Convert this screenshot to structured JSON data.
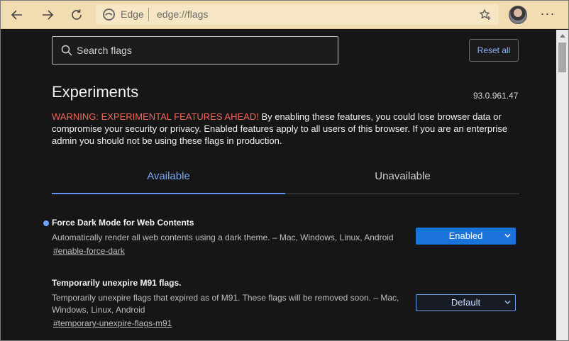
{
  "browser": {
    "site_label": "Edge",
    "url": "edge://flags",
    "icons": [
      "back-icon",
      "forward-icon",
      "refresh-icon",
      "edge-logo-icon",
      "favorite-icon",
      "more-icon"
    ],
    "more_label": "···"
  },
  "header": {
    "search_placeholder": "Search flags",
    "reset_label": "Reset all",
    "title": "Experiments",
    "version": "93.0.961.47",
    "warning_head": "WARNING: EXPERIMENTAL FEATURES AHEAD!",
    "warning_body": " By enabling these features, you could lose browser data or compromise your security or privacy. Enabled features apply to all users of this browser. If you are an enterprise admin you should not be using these flags in production."
  },
  "tabs": [
    {
      "label": "Available",
      "selected": true
    },
    {
      "label": "Unavailable",
      "selected": false
    }
  ],
  "flags": [
    {
      "title": "Force Dark Mode for Web Contents",
      "description": "Automatically render all web contents using a dark theme. – Mac, Windows, Linux, Android",
      "link": "#enable-force-dark",
      "value": "Enabled",
      "modified": true
    },
    {
      "title": "Temporarily unexpire M91 flags.",
      "description": "Temporarily unexpire flags that expired as of M91. These flags will be removed soon. – Mac, Windows, Linux, Android",
      "link": "#temporary-unexpire-flags-m91",
      "value": "Default",
      "modified": false
    }
  ],
  "colors": {
    "toolbar": "#f2ddb3",
    "accent": "#1a73d9",
    "warning": "#f2665d",
    "link_blue": "#8ab4f8"
  }
}
